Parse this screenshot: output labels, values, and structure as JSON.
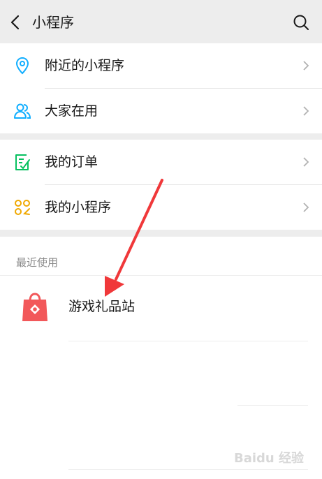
{
  "header": {
    "title": "小程序",
    "back_icon": "chevron-left-icon",
    "search_icon": "search-icon"
  },
  "menu": {
    "group1": [
      {
        "label": "附近的小程序",
        "icon": "location-pin-icon",
        "color": "#10aeff"
      },
      {
        "label": "大家在用",
        "icon": "people-icon",
        "color": "#10aeff"
      }
    ],
    "group2": [
      {
        "label": "我的订单",
        "icon": "order-list-icon",
        "color": "#07c160"
      },
      {
        "label": "我的小程序",
        "icon": "mini-program-grid-icon",
        "color": "#f0a800"
      }
    ]
  },
  "recent": {
    "header": "最近使用",
    "items": [
      {
        "label": "游戏礼品站",
        "icon": "shopping-bag-icon",
        "color": "#f2585a"
      }
    ]
  },
  "annotation": {
    "arrow_color": "#f0383a"
  },
  "watermark": {
    "text": "Baidu 经验"
  }
}
